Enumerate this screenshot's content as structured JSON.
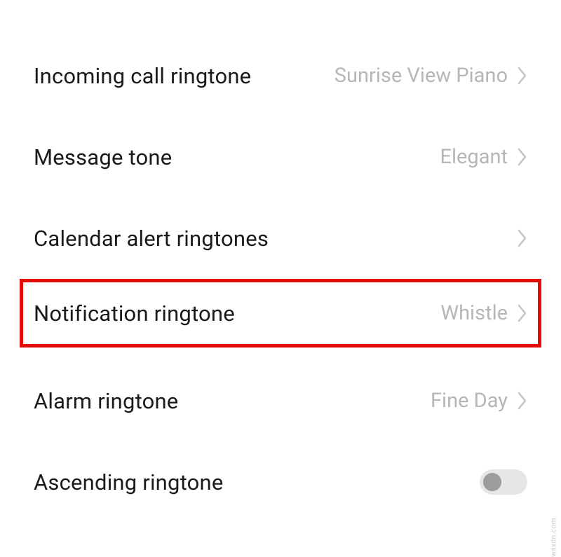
{
  "rows": {
    "incoming_call": {
      "label": "Incoming call ringtone",
      "value": "Sunrise View Piano"
    },
    "message_tone": {
      "label": "Message tone",
      "value": "Elegant"
    },
    "calendar_alert": {
      "label": "Calendar alert ringtones",
      "value": ""
    },
    "notification": {
      "label": "Notification ringtone",
      "value": "Whistle"
    },
    "alarm": {
      "label": "Alarm ringtone",
      "value": "Fine Day"
    },
    "ascending": {
      "label": "Ascending ringtone"
    }
  },
  "watermark": "wsxdn.com"
}
